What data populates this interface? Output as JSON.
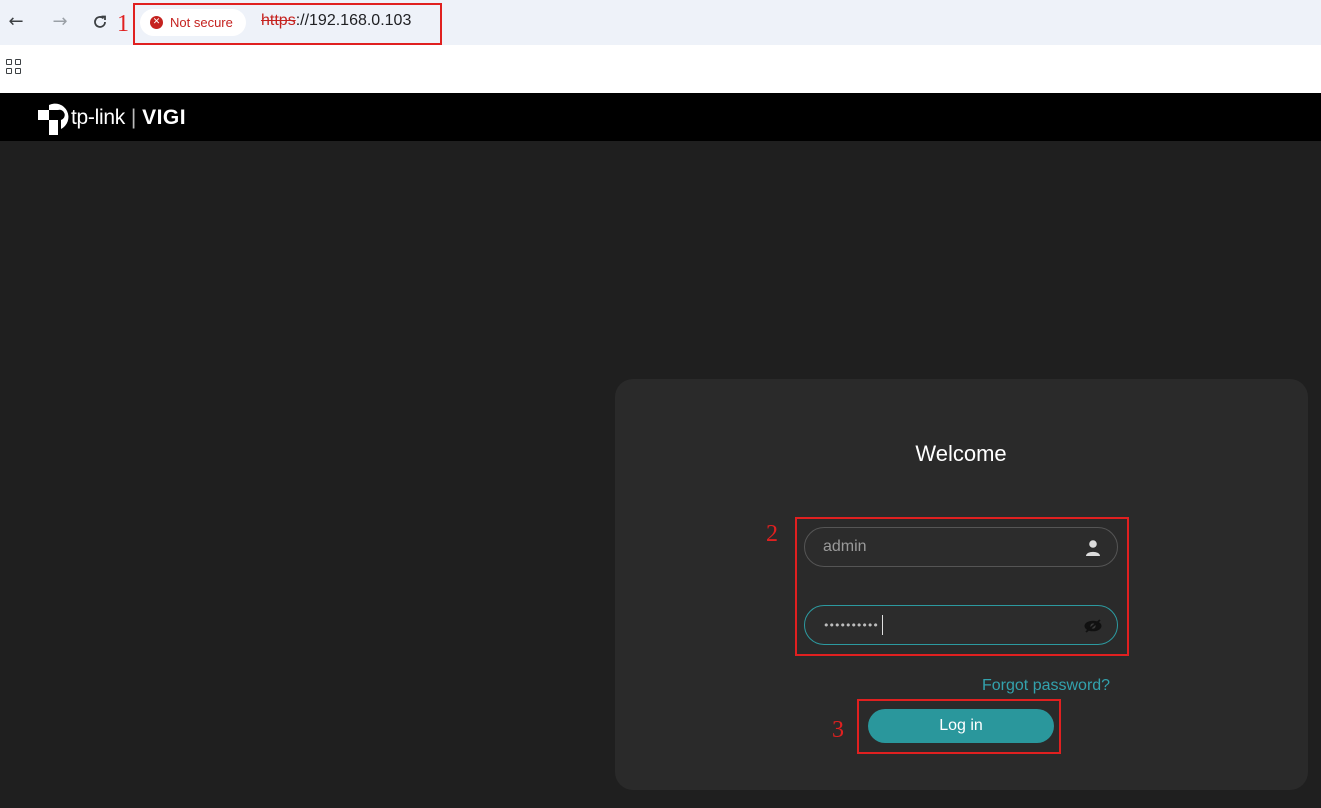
{
  "browser": {
    "back_icon": "arrow-left-icon",
    "forward_icon": "arrow-right-icon",
    "reload_icon": "reload-icon",
    "security_chip": {
      "icon": "error-circle-icon",
      "label": "Not secure",
      "color": "#c5221f"
    },
    "url": {
      "protocol": "https",
      "rest": "://192.168.0.103"
    },
    "apps_icon": "apps-grid-icon"
  },
  "app": {
    "brand": {
      "name": "tp-link",
      "separator": "|",
      "product": "VIGI"
    }
  },
  "login": {
    "title": "Welcome",
    "username": {
      "value": "admin",
      "icon": "user-icon"
    },
    "password": {
      "masked_value": "••••••••••",
      "icon": "eye-hidden-icon"
    },
    "forgot_link": "Forgot password?",
    "submit_label": "Log in",
    "accent_color": "#2a979c"
  },
  "annotations": [
    {
      "number": "1",
      "color": "#e02020"
    },
    {
      "number": "2",
      "color": "#e02020"
    },
    {
      "number": "3",
      "color": "#e02020"
    }
  ]
}
